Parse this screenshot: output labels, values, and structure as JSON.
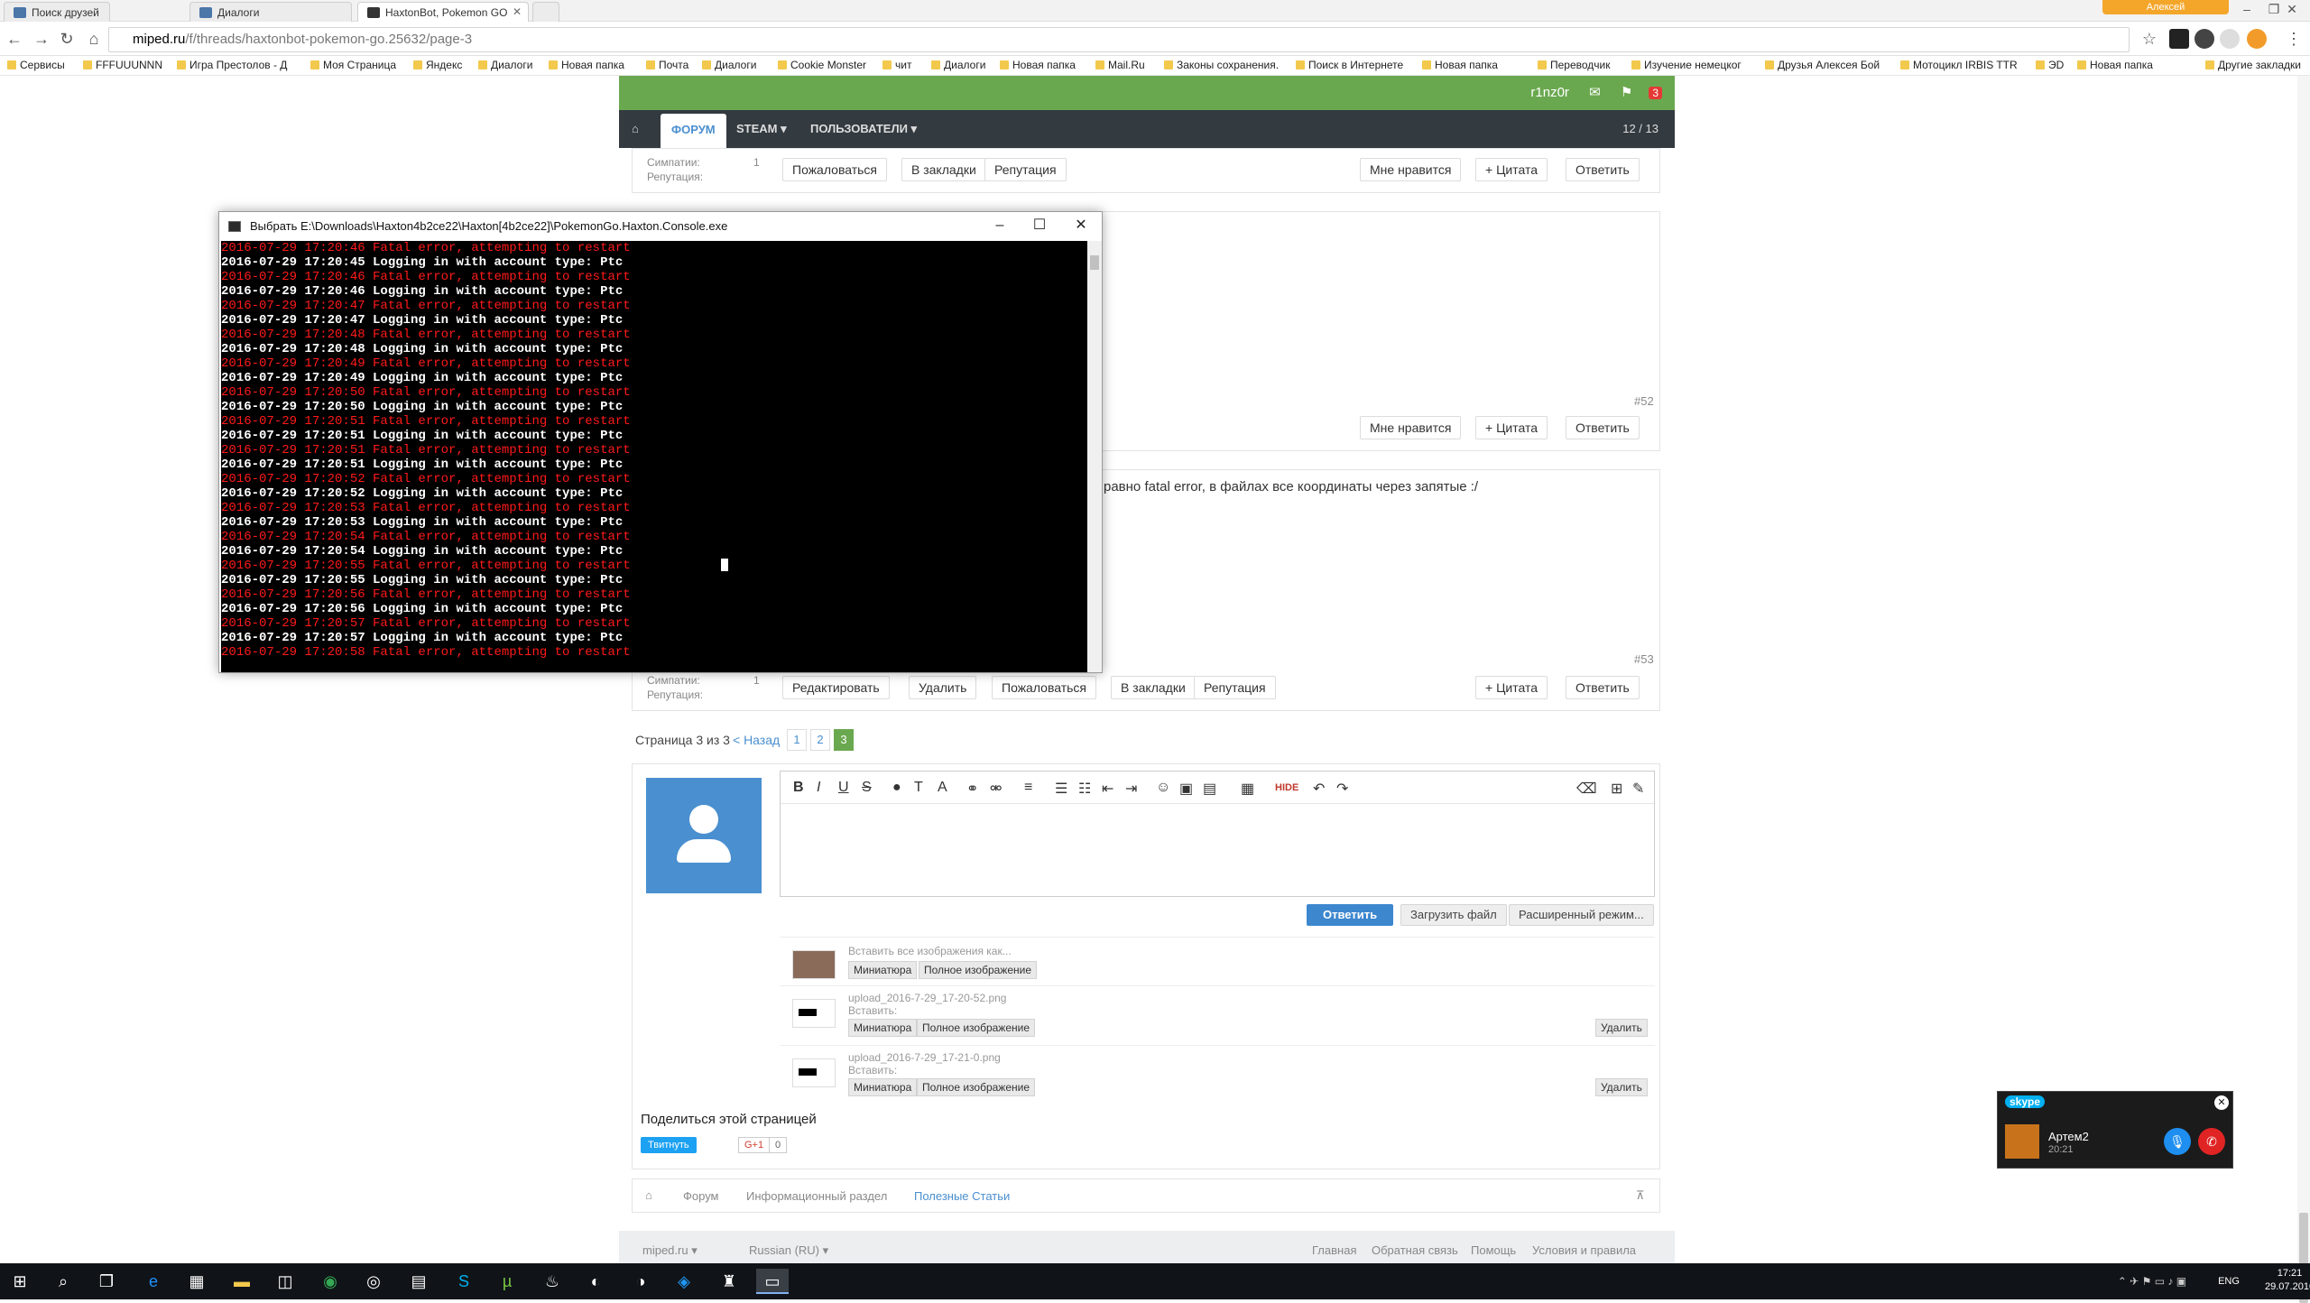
{
  "browser": {
    "tabs": [
      {
        "label": "Поиск друзей"
      },
      {
        "label": "Диалоги"
      },
      {
        "label": "HaxtonBot, Pokemon GO"
      }
    ],
    "profile": "Алексей",
    "url_host": "miped.ru",
    "url_path": "/f/threads/haxtonbot-pokemon-go.25632/page-3",
    "bookmarks": [
      "Сервисы",
      "FFFUUUNNN",
      "Игра Престолов - Д",
      "Моя Страница",
      "Яндекс",
      "Диалоги",
      "Новая папка",
      "Почта",
      "Диалоги",
      "Cookie Monster",
      "чит",
      "Диалоги",
      "Новая папка",
      "Mail.Ru",
      "Законы сохранения.",
      "Поиск в Интернете",
      "Новая папка",
      "Переводчик",
      "Изучение немецког",
      "Друзья Алексея Бой",
      "Мотоцикл IRBIS TTR",
      "ЭD",
      "Новая папка",
      "Другие закладки"
    ]
  },
  "forum": {
    "username": "r1nz0r",
    "alerts": "3",
    "nav": {
      "home": "⌂",
      "forum": "ФОРУМ",
      "steam": "STEAM ▾",
      "users": "ПОЛЬЗОВАТЕЛИ ▾",
      "pager": "12 / 13"
    },
    "post1": {
      "sympathy_label": "Симпатии:",
      "sympathy_val": "1",
      "rep_label": "Репутация:",
      "btns": [
        "Пожаловаться",
        "В закладки",
        "Репутация"
      ],
      "like": "Мне нравится",
      "quote": "+ Цитата",
      "reply": "Ответить"
    },
    "post2": {
      "num": "#52",
      "like": "Мне нравится",
      "quote": "+ Цитата",
      "reply": "Ответить"
    },
    "post3": {
      "text": "равно fatal error, в файлах все координаты через запятые :/",
      "num": "#53",
      "sympathy_label": "Симпатии:",
      "sympathy_val": "1",
      "rep_label": "Репутация:",
      "btns": [
        "Редактировать",
        "Удалить",
        "Пожаловаться",
        "В закладки",
        "Репутация"
      ],
      "quote": "+ Цитата",
      "reply": "Ответить"
    },
    "pagination": {
      "label": "Страница 3 из 3",
      "back": "< Назад",
      "p1": "1",
      "p2": "2",
      "p3": "3"
    },
    "editor": {
      "reply": "Ответить",
      "upload": "Загрузить файл",
      "advanced": "Расширенный режим..."
    },
    "attach_all": {
      "label": "Вставить все изображения как...",
      "thumb": "Миниатюра",
      "full": "Полное изображение"
    },
    "attachments": [
      {
        "name": "upload_2016-7-29_17-20-52.png",
        "insert": "Вставить:",
        "thumb": "Миниатюра",
        "full": "Полное изображение",
        "del": "Удалить"
      },
      {
        "name": "upload_2016-7-29_17-21-0.png",
        "insert": "Вставить:",
        "thumb": "Миниатюра",
        "full": "Полное изображение",
        "del": "Удалить"
      }
    ],
    "share": {
      "title": "Поделиться этой страницей",
      "tweet": "Твитнуть",
      "gplus": "G+1",
      "count": "0"
    },
    "breadcrumb": [
      "Форум",
      "Информационный раздел",
      "Полезные Статьи"
    ],
    "footer": {
      "site": "miped.ru ▾",
      "lang": "Russian (RU) ▾",
      "links": [
        "Главная",
        "Обратная связь",
        "Помощь",
        "Условия и правила"
      ]
    }
  },
  "console": {
    "title": "Выбрать E:\\Downloads\\Haxton4b2ce22\\Haxton[4b2ce22]\\PokemonGo.Haxton.Console.exe",
    "lines": [
      {
        "t": "2016-07-29 17:20:46 Fatal error, attempting to restart",
        "err": true
      },
      {
        "t": "2016-07-29 17:20:45 Logging in with account type: Ptc",
        "err": false
      },
      {
        "t": "2016-07-29 17:20:46 Fatal error, attempting to restart",
        "err": true
      },
      {
        "t": "2016-07-29 17:20:46 Logging in with account type: Ptc",
        "err": false
      },
      {
        "t": "2016-07-29 17:20:47 Fatal error, attempting to restart",
        "err": true
      },
      {
        "t": "2016-07-29 17:20:47 Logging in with account type: Ptc",
        "err": false
      },
      {
        "t": "2016-07-29 17:20:48 Fatal error, attempting to restart",
        "err": true
      },
      {
        "t": "2016-07-29 17:20:48 Logging in with account type: Ptc",
        "err": false
      },
      {
        "t": "2016-07-29 17:20:49 Fatal error, attempting to restart",
        "err": true
      },
      {
        "t": "2016-07-29 17:20:49 Logging in with account type: Ptc",
        "err": false
      },
      {
        "t": "2016-07-29 17:20:50 Fatal error, attempting to restart",
        "err": true
      },
      {
        "t": "2016-07-29 17:20:50 Logging in with account type: Ptc",
        "err": false
      },
      {
        "t": "2016-07-29 17:20:51 Fatal error, attempting to restart",
        "err": true
      },
      {
        "t": "2016-07-29 17:20:51 Logging in with account type: Ptc",
        "err": false
      },
      {
        "t": "2016-07-29 17:20:51 Fatal error, attempting to restart",
        "err": true
      },
      {
        "t": "2016-07-29 17:20:51 Logging in with account type: Ptc",
        "err": false
      },
      {
        "t": "2016-07-29 17:20:52 Fatal error, attempting to restart",
        "err": true
      },
      {
        "t": "2016-07-29 17:20:52 Logging in with account type: Ptc",
        "err": false
      },
      {
        "t": "2016-07-29 17:20:53 Fatal error, attempting to restart",
        "err": true
      },
      {
        "t": "2016-07-29 17:20:53 Logging in with account type: Ptc",
        "err": false
      },
      {
        "t": "2016-07-29 17:20:54 Fatal error, attempting to restart",
        "err": true
      },
      {
        "t": "2016-07-29 17:20:54 Logging in with account type: Ptc",
        "err": false
      },
      {
        "t": "2016-07-29 17:20:55 Fatal error, attempting to restart",
        "err": true
      },
      {
        "t": "2016-07-29 17:20:55 Logging in with account type: Ptc",
        "err": false
      },
      {
        "t": "2016-07-29 17:20:56 Fatal error, attempting to restart",
        "err": true
      },
      {
        "t": "2016-07-29 17:20:56 Logging in with account type: Ptc",
        "err": false
      },
      {
        "t": "2016-07-29 17:20:57 Fatal error, attempting to restart",
        "err": true
      },
      {
        "t": "2016-07-29 17:20:57 Logging in with account type: Ptc",
        "err": false
      },
      {
        "t": "2016-07-29 17:20:58 Fatal error, attempting to restart",
        "err": true
      }
    ]
  },
  "skype": {
    "brand": "skype",
    "contact": "Артем2",
    "time": "20:21"
  },
  "taskbar": {
    "lang": "ENG",
    "time": "17:21",
    "date": "29.07.2016"
  },
  "colors": {
    "forum_green": "#6aa84f",
    "forum_nav": "#333a40",
    "accent_blue": "#3d87cf",
    "error_red": "#ff1a1a"
  }
}
